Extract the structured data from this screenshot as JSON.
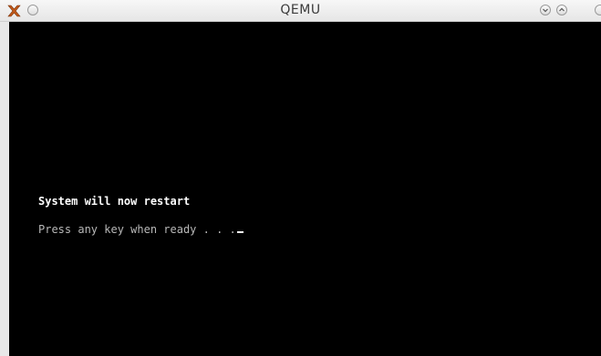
{
  "window": {
    "title": "QEMU"
  },
  "titlebar_icons": {
    "app": "x-app-icon",
    "left": "circle-icon",
    "minimize": "chevron-down-icon",
    "maximize": "chevron-up-icon",
    "close": "close-icon"
  },
  "console": {
    "line1": "System will now restart",
    "line2": "Press any key when ready . . ."
  },
  "colors": {
    "screen_background": "#000000",
    "text_bright": "#ffffff",
    "text_dim": "#b8b8b8"
  }
}
